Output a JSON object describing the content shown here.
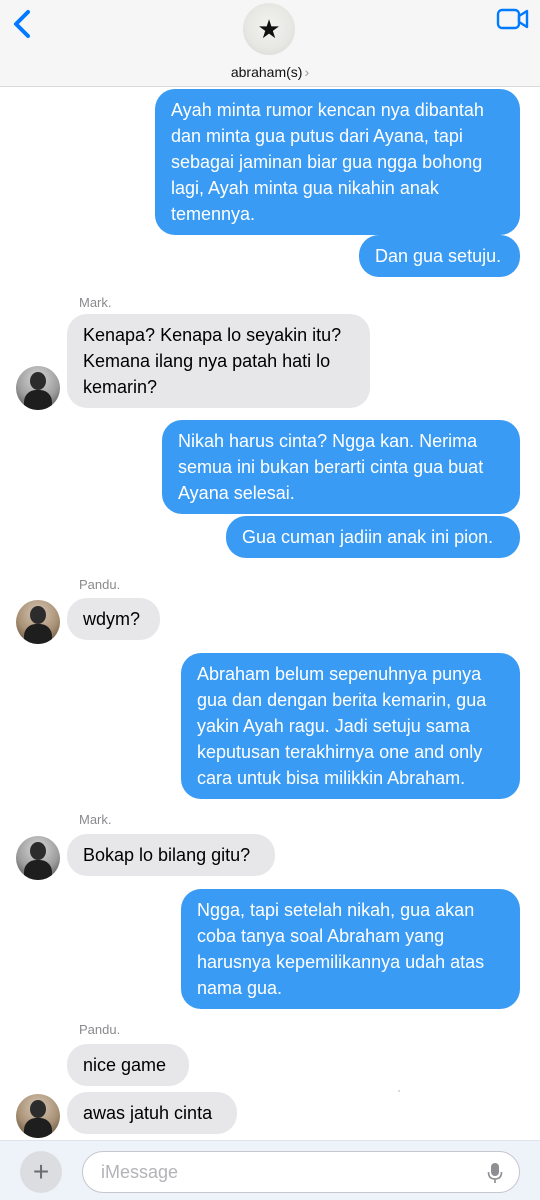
{
  "header": {
    "contact_name": "abraham(s)",
    "chevron": "›"
  },
  "icons": {
    "back": "chevron-left-icon",
    "video": "video-camera-icon",
    "avatar_star": "★",
    "add": "+",
    "mic": "microphone-icon"
  },
  "colors": {
    "accent": "#007aff",
    "outgoing_bubble": "#3a9bf4",
    "incoming_bubble": "#e7e7ea"
  },
  "messages": [
    {
      "dir": "out",
      "text": "Ayah minta rumor kencan nya dibantah dan minta gua putus dari Ayana, tapi sebagai jaminan biar gua ngga bohong lagi, Ayah minta gua nikahin anak temennya."
    },
    {
      "dir": "out",
      "text": "Dan gua setuju."
    },
    {
      "dir": "in",
      "sender": "Mark.",
      "text": "Kenapa? Kenapa lo seyakin itu? Kemana ilang nya patah hati lo kemarin?"
    },
    {
      "dir": "out",
      "text": "Nikah harus cinta? Ngga kan. Nerima semua ini bukan berarti cinta gua buat Ayana selesai."
    },
    {
      "dir": "out",
      "text": "Gua cuman jadiin anak ini pion."
    },
    {
      "dir": "in",
      "sender": "Pandu.",
      "text": "wdym?"
    },
    {
      "dir": "out",
      "text": "Abraham belum sepenuhnya punya gua dan dengan berita kemarin, gua yakin Ayah ragu. Jadi setuju sama keputusan terakhirnya one and only cara untuk bisa milikkin Abraham."
    },
    {
      "dir": "in",
      "sender": "Mark.",
      "text": "Bokap lo bilang gitu?"
    },
    {
      "dir": "out",
      "text": "Ngga, tapi setelah nikah, gua akan coba tanya soal Abraham yang harusnya kepemilikannya udah atas nama gua."
    },
    {
      "dir": "in",
      "sender": "Pandu.",
      "text": "nice game"
    },
    {
      "dir": "in",
      "text": "awas jatuh cinta"
    }
  ],
  "input": {
    "placeholder": "iMessage",
    "value": ""
  }
}
